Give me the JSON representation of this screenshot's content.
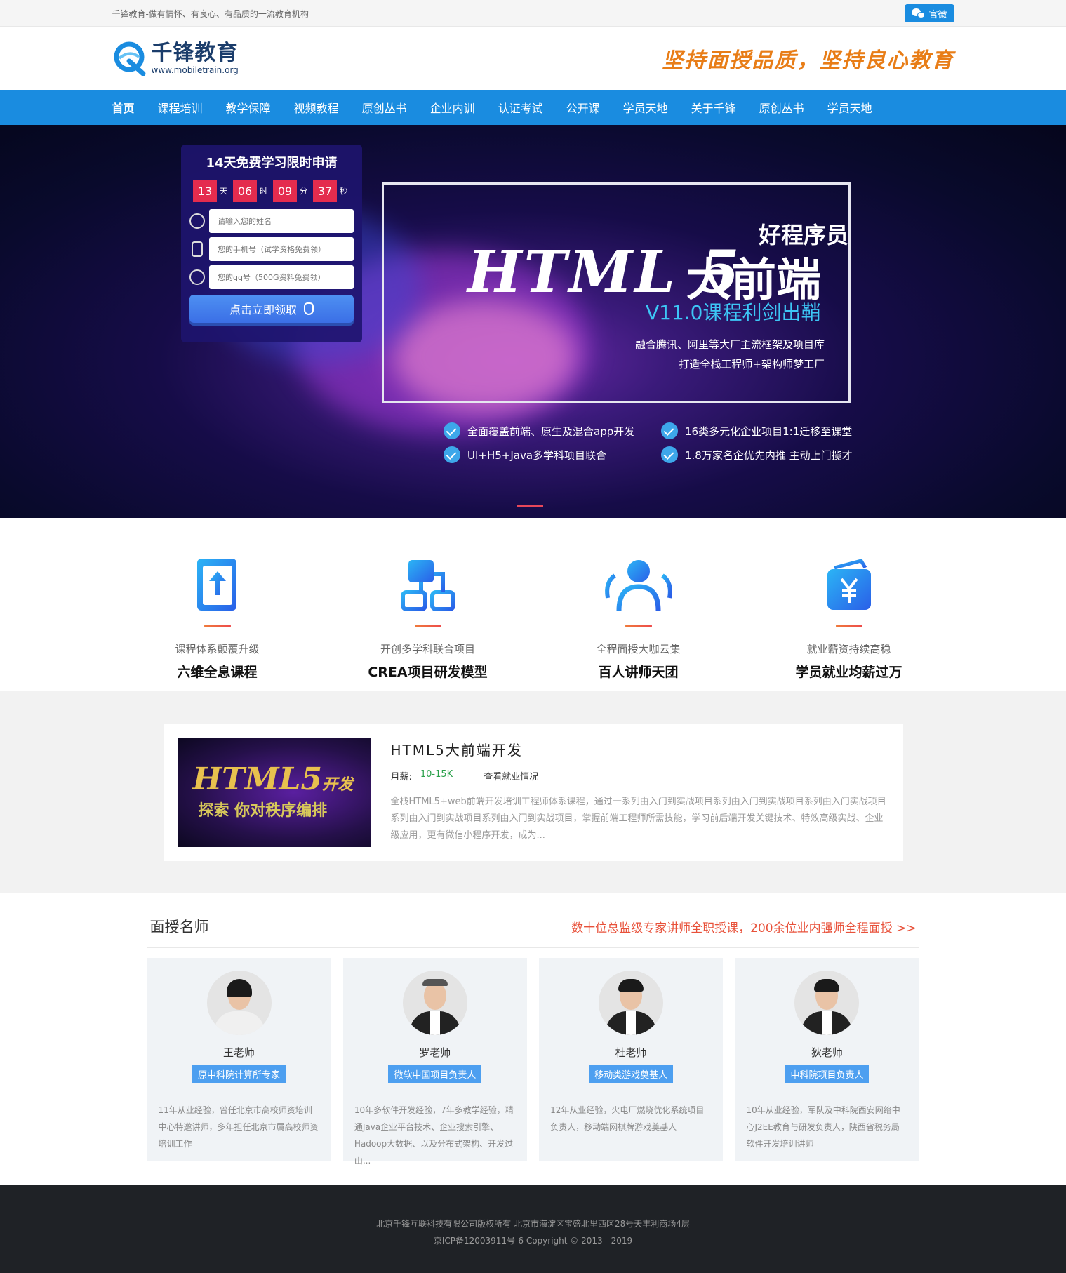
{
  "topbar": {
    "slogan": "千锋教育-做有情怀、有良心、有品质的一流教育机构",
    "wechat_label": "官微"
  },
  "header": {
    "logo_name": "千锋教育",
    "logo_url": "www.mobiletrain.org",
    "slogan": "坚持面授品质，坚持良心教育"
  },
  "nav": [
    {
      "label": "首页",
      "active": true
    },
    {
      "label": "课程培训"
    },
    {
      "label": "教学保障"
    },
    {
      "label": "视频教程"
    },
    {
      "label": "原创丛书"
    },
    {
      "label": "企业内训"
    },
    {
      "label": "认证考试"
    },
    {
      "label": "公开课"
    },
    {
      "label": "学员天地"
    },
    {
      "label": "关于千锋"
    },
    {
      "label": "原创丛书"
    },
    {
      "label": "学员天地"
    }
  ],
  "apply": {
    "title": "14天免费学习限时申请",
    "countdown": {
      "days": "13",
      "days_unit": "天",
      "hours": "06",
      "hours_unit": "时",
      "minutes": "09",
      "minutes_unit": "分",
      "seconds": "37",
      "seconds_unit": "秒"
    },
    "name_placeholder": "请输入您的姓名",
    "phone_placeholder": "您的手机号（试学资格免费领）",
    "qq_placeholder": "您的qq号（500G资料免费领）",
    "submit_label": "点击立即领取"
  },
  "banner": {
    "subtitle": "好程序员",
    "html5": "HTML 5",
    "big": "大前端",
    "version": "V11.0课程利剑出鞘",
    "line1": "融合腾讯、阿里等大厂主流框架及项目库",
    "line2": "打造全栈工程师+架构师梦工厂",
    "features": [
      "全面覆盖前端、原生及混合app开发",
      "16类多元化企业项目1:1迁移至课堂",
      "UI+H5+Java多学科项目联合",
      "1.8万家名企优先内推 主动上门揽才"
    ]
  },
  "features": [
    {
      "small": "课程体系颠覆升级",
      "big": "六维全息课程",
      "icon": "book-upload-icon"
    },
    {
      "small": "开创多学科联合项目",
      "big": "CREA项目研发模型",
      "icon": "diagram-blocks-icon"
    },
    {
      "small": "全程面授大咖云集",
      "big": "百人讲师天团",
      "icon": "people-icon"
    },
    {
      "small": "就业薪资持续高稳",
      "big": "学员就业均薪过万",
      "icon": "wallet-yen-icon"
    }
  ],
  "course": {
    "image_text1": "HTML5",
    "image_text1b": "开发",
    "image_text2": "探索 你对秩序编排",
    "title": "HTML5大前端开发",
    "salary_label": "月薪:",
    "salary_value": "10-15K",
    "jobs_link": "查看就业情况",
    "desc": "全栈HTML5+web前端开发培训工程师体系课程，通过一系列由入门到实战项目系列由入门到实战项目系列由入门实战项目系列由入门到实战项目系列由入门到实战项目，掌握前端工程师所需技能，学习前后端开发关键技术、特效高级实战、企业级应用，更有微信小程序开发，成为..."
  },
  "teachers": {
    "title": "面授名师",
    "more": "数十位总监级专家讲师全职授课，200余位业内强师全程面授 >>",
    "list": [
      {
        "name": "王老师",
        "badge": "原中科院计算所专家",
        "desc": "11年从业经验，曾任北京市高校师资培训中心特邀讲师，多年担任北京市属高校师资培训工作"
      },
      {
        "name": "罗老师",
        "badge": "微软中国项目负责人",
        "desc": "10年多软件开发经验，7年多教学经验，精通Java企业平台技术、企业搜索引擎、Hadoop大数据、以及分布式架构、开发过山..."
      },
      {
        "name": "杜老师",
        "badge": "移动类游戏奠基人",
        "desc": "12年从业经验，火电厂燃烧优化系统项目负责人，移动端网棋牌游戏奠基人"
      },
      {
        "name": "狄老师",
        "badge": "中科院项目负责人",
        "desc": "10年从业经验，军队及中科院西安网络中心J2EE教育与研发负责人，陕西省税务局软件开发培训讲师"
      }
    ]
  },
  "footer": {
    "line1": "北京千锋互联科技有限公司版权所有   北京市海淀区宝盛北里西区28号天丰利商场4层",
    "line2": "京ICP备12003911号-6   Copyright © 2013 - 2019"
  }
}
